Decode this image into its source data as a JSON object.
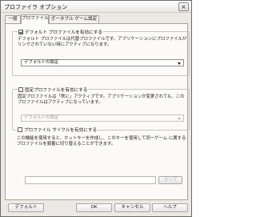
{
  "window": {
    "title": "プロファイラ オプション",
    "close_glyph": "×"
  },
  "tabs": [
    {
      "label": "一般",
      "active": false
    },
    {
      "label": "プロファイル",
      "active": true
    },
    {
      "label": "ポータブル ゲーム設定",
      "active": false
    }
  ],
  "default_profile": {
    "checkbox_label": "デフォルト プロファイルを有効にする",
    "checked": true,
    "description": "デフォルト プロファイルは代替プロファイルです。アプリケーションにプロファイルがリンクされていない時にアクティブになります。",
    "selected_value": "デフォルトの設定"
  },
  "fixed_profile": {
    "checkbox_label": "固定プロファイルを有効にする",
    "checked": false,
    "description": "固定プロファイルは「常に」アクティブです。アプリケーションが変更されても、このプロファイルはアクティブになっています。",
    "selected_value": "デフォルトの設定"
  },
  "profile_cycle": {
    "checkbox_label": "プロファイル サイクルを有効にする",
    "checked": false,
    "description": "この機能を使用すると、ホットキーを作成し、このキーを使用して同一ゲーム に属するプロファイルを順番に切り替えることができます。",
    "hotkey_value": "",
    "clear_label": "クリア"
  },
  "footer": {
    "default_label": "デフォルト",
    "ok_label": "OK",
    "cancel_label": "キャンセル",
    "help_label": "ヘルプ"
  }
}
